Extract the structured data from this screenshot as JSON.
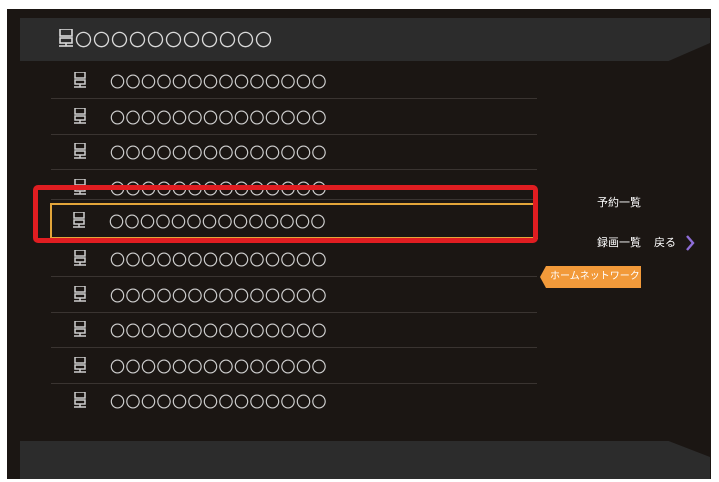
{
  "header": {
    "title": "〇〇〇〇〇〇〇〇〇〇〇",
    "icon": "server-icon"
  },
  "list": {
    "items": [
      {
        "label": "〇〇〇〇〇〇〇〇〇〇〇〇〇〇",
        "icon": "server-icon",
        "selected": false
      },
      {
        "label": "〇〇〇〇〇〇〇〇〇〇〇〇〇〇",
        "icon": "server-icon",
        "selected": false
      },
      {
        "label": "〇〇〇〇〇〇〇〇〇〇〇〇〇〇",
        "icon": "server-icon",
        "selected": false
      },
      {
        "label": "〇〇〇〇〇〇〇〇〇〇〇〇〇〇",
        "icon": "server-icon",
        "selected": false
      },
      {
        "label": "〇〇〇〇〇〇〇〇〇〇〇〇〇〇",
        "icon": "server-icon",
        "selected": true
      },
      {
        "label": "〇〇〇〇〇〇〇〇〇〇〇〇〇〇",
        "icon": "server-icon",
        "selected": false
      },
      {
        "label": "〇〇〇〇〇〇〇〇〇〇〇〇〇〇",
        "icon": "server-icon",
        "selected": false
      },
      {
        "label": "〇〇〇〇〇〇〇〇〇〇〇〇〇〇",
        "icon": "server-icon",
        "selected": false
      },
      {
        "label": "〇〇〇〇〇〇〇〇〇〇〇〇〇〇",
        "icon": "server-icon",
        "selected": false
      },
      {
        "label": "〇〇〇〇〇〇〇〇〇〇〇〇〇〇",
        "icon": "server-icon",
        "selected": false
      }
    ]
  },
  "side_menu": {
    "reservation_list": "予約一覧",
    "recording_list": "録画一覧",
    "back": "戻る",
    "back_icon": "chevron-right-icon",
    "home_network_tab": "ホームネットワーク"
  },
  "colors": {
    "background": "#1b1613",
    "bar": "#2c2c2c",
    "selection_border": "#e3a53a",
    "highlight": "#e01d21",
    "home_tab": "#f29a3a",
    "chevron": "#8e6dd8"
  }
}
